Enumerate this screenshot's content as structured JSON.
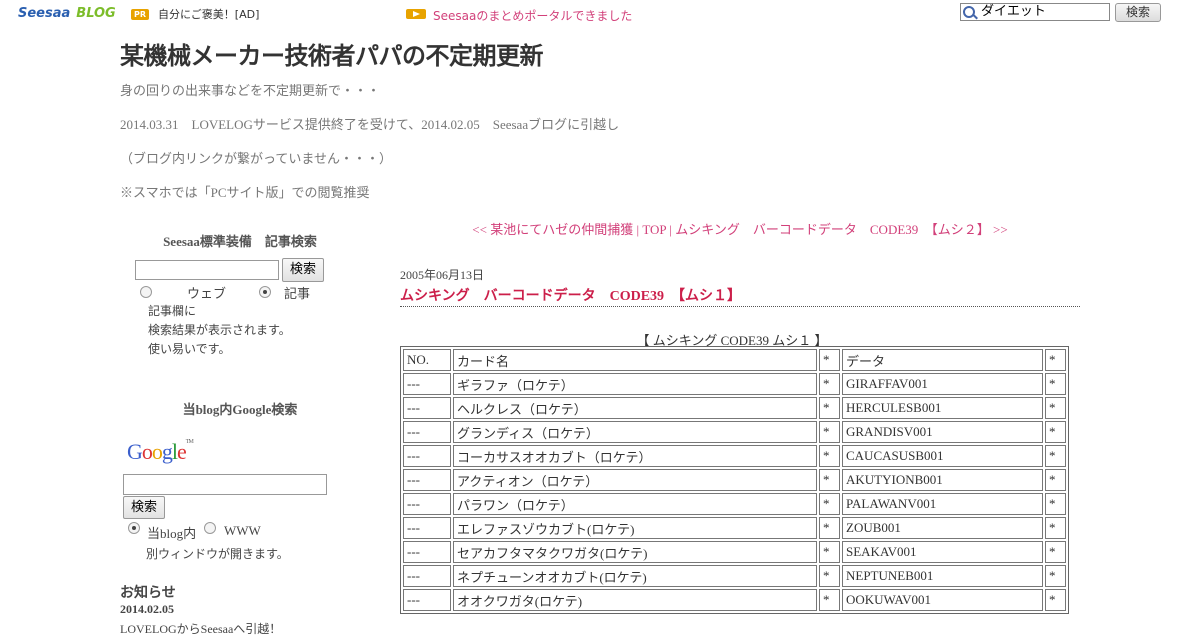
{
  "topbar": {
    "logo_main": "Seesaa",
    "logo_sub": "BLOG",
    "pr_badge": "PR",
    "pr_text": "自分にご褒美！[AD]",
    "portal_link": "Seesaaのまとめポータルできました",
    "search_value": "ダイエット",
    "search_button": "検索"
  },
  "header": {
    "title": "某機械メーカー技術者パパの不定期更新",
    "desc_lines": [
      "身の回りの出来事などを不定期更新で・・・",
      "2014.03.31　LOVELOGサービス提供終了を受けて、2014.02.05　Seesaaブログに引越し",
      "（ブログ内リンクが繋がっていません・・・）",
      "※スマホでは「PCサイト版」での閲覧推奨"
    ]
  },
  "sidebar": {
    "blog_search": {
      "heading": "Seesaa標準装備　記事検索",
      "button": "検索",
      "radio_web": "ウェブ",
      "radio_article": "記事",
      "selected": "記事",
      "notes": [
        "記事欄に",
        "検索結果が表示されます。",
        "使い易いです。"
      ]
    },
    "google_search": {
      "heading": "当blog内Google検索",
      "logo": "Google",
      "button": "検索",
      "radio_blog": "当blog内",
      "radio_www": "WWW",
      "selected": "当blog内",
      "note": "別ウィンドウが開きます。"
    },
    "notice": {
      "heading": "お知らせ",
      "date": "2014.02.05",
      "text": "LOVELOGからSeesaaへ引越！"
    }
  },
  "main": {
    "nav": {
      "prev": "<< 某池にてハゼの仲間捕獲",
      "sep1": " | ",
      "top": "TOP",
      "sep2": " | ",
      "next": "ムシキング　バーコードデータ　CODE39　【ムシ２】 >>"
    },
    "post": {
      "date": "2005年06月13日",
      "title": "ムシキング　バーコードデータ　CODE39　【ムシ１】",
      "table_caption": "【 ムシキング CODE39 ムシ１ 】",
      "table": {
        "headers": [
          "NO.",
          "カード名",
          "*",
          "データ",
          "*"
        ],
        "rows": [
          [
            "---",
            "ギラファ（ロケテ）",
            "*",
            "GIRAFFAV001",
            "*"
          ],
          [
            "---",
            "ヘルクレス（ロケテ）",
            "*",
            "HERCULESB001",
            "*"
          ],
          [
            "---",
            "グランディス（ロケテ）",
            "*",
            "GRANDISV001",
            "*"
          ],
          [
            "---",
            "コーカサスオオカブト（ロケテ）",
            "*",
            "CAUCASUSB001",
            "*"
          ],
          [
            "---",
            "アクティオン（ロケテ）",
            "*",
            "AKUTYIONB001",
            "*"
          ],
          [
            "---",
            "パラワン（ロケテ）",
            "*",
            "PALAWANV001",
            "*"
          ],
          [
            "---",
            "エレファスゾウカブト(ロケテ)",
            "*",
            "ZOUB001",
            "*"
          ],
          [
            "---",
            "セアカフタマタクワガタ(ロケテ)",
            "*",
            "SEAKAV001",
            "*"
          ],
          [
            "---",
            "ネプチューンオオカブト(ロケテ)",
            "*",
            "NEPTUNEB001",
            "*"
          ],
          [
            "---",
            "オオクワガタ(ロケテ)",
            "*",
            "OOKUWAV001",
            "*"
          ]
        ]
      }
    }
  }
}
